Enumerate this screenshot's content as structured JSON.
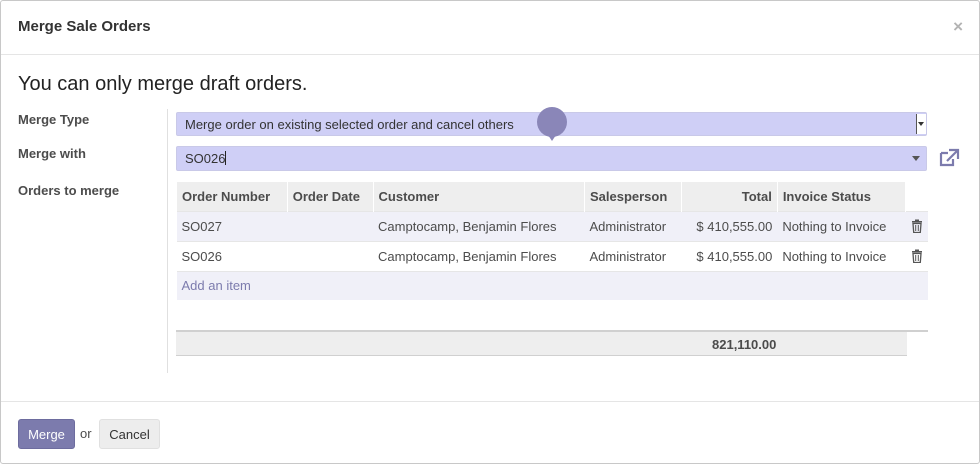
{
  "dialog": {
    "title": "Merge Sale Orders",
    "close_symbol": "×"
  },
  "warning": "You can only merge draft orders.",
  "fields": {
    "merge_type_label": "Merge Type",
    "merge_type_value": "Merge order on existing selected order and cancel others",
    "merge_with_label": "Merge with",
    "merge_with_value": "SO026",
    "orders_label": "Orders to merge"
  },
  "table": {
    "columns": [
      "Order Number",
      "Order Date",
      "Customer",
      "Salesperson",
      "Total",
      "Invoice Status"
    ],
    "rows": [
      {
        "order_number": "SO027",
        "order_date": "",
        "customer": "Camptocamp, Benjamin Flores",
        "salesperson": "Administrator",
        "total": "$ 410,555.00",
        "invoice_status": "Nothing to Invoice"
      },
      {
        "order_number": "SO026",
        "order_date": "",
        "customer": "Camptocamp, Benjamin Flores",
        "salesperson": "Administrator",
        "total": "$ 410,555.00",
        "invoice_status": "Nothing to Invoice"
      }
    ],
    "add_item": "Add an item",
    "grand_total": "821,110.00"
  },
  "footer": {
    "merge_label": "Merge",
    "or_text": "or",
    "cancel_label": "Cancel"
  },
  "colors": {
    "accent": "#7c7bad",
    "selection_bg": "#cfcff6",
    "pin": "#8a86b8"
  },
  "icons": [
    "close-icon",
    "dropdown-arrow-icon",
    "external-link-icon",
    "trash-icon",
    "map-pin-icon"
  ]
}
